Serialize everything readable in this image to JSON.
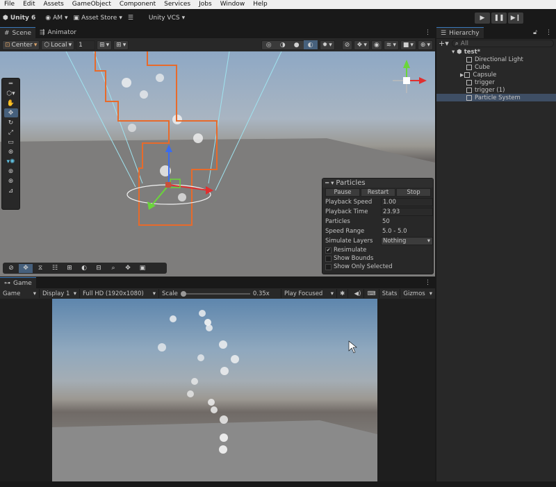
{
  "menu": [
    "File",
    "Edit",
    "Assets",
    "GameObject",
    "Component",
    "Services",
    "Jobs",
    "Window",
    "Help"
  ],
  "toolbar": {
    "unity": "Unity 6",
    "account": "AM",
    "store": "Asset Store",
    "vcs": "Unity VCS"
  },
  "tabs": {
    "scene": "Scene",
    "animator": "Animator",
    "game": "Game",
    "hierarchy": "Hierarchy"
  },
  "scene_toolbar": {
    "pivot": "Center",
    "space": "Local",
    "snap": "1"
  },
  "particles": {
    "title": "Particles",
    "pause": "Pause",
    "restart": "Restart",
    "stop": "Stop",
    "rows": [
      {
        "label": "Playback Speed",
        "value": "1.00"
      },
      {
        "label": "Playback Time",
        "value": "23.93"
      },
      {
        "label": "Particles",
        "value": "50"
      },
      {
        "label": "Speed Range",
        "value": "5.0 - 5.0"
      },
      {
        "label": "Simulate Layers",
        "value": "Nothing"
      }
    ],
    "resimulate": "Resimulate",
    "show_bounds": "Show Bounds",
    "show_only_selected": "Show Only Selected"
  },
  "game_toolbar": {
    "mode": "Game",
    "display": "Display 1",
    "resolution": "Full HD (1920x1080)",
    "scale_label": "Scale",
    "scale_value": "0.35x",
    "play_focused": "Play Focused",
    "stats": "Stats",
    "gizmos": "Gizmos"
  },
  "hierarchy": {
    "search_placeholder": "All",
    "scene": "test*",
    "items": [
      "Directional Light",
      "Cube",
      "Capsule",
      "trigger",
      "trigger (1)",
      "Particle System"
    ]
  },
  "colors": {
    "accent": "#3a79bb",
    "selection": "#3e4e64",
    "bounds": "#e86a2a"
  },
  "icons": {
    "play": "play-icon",
    "pause": "pause-icon",
    "step": "step-icon"
  }
}
